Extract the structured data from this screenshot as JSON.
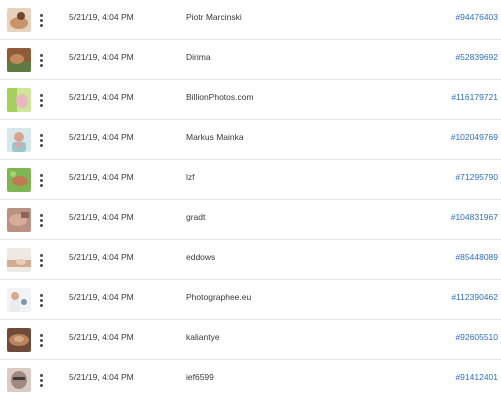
{
  "rows": [
    {
      "date": "5/21/19, 4:04 PM",
      "author": "Piotr Marcinski",
      "asset_id": "#94476403",
      "thumb_colors": [
        "#d9b48c",
        "#8a5a3a"
      ]
    },
    {
      "date": "5/21/19, 4:04 PM",
      "author": "Dirima",
      "asset_id": "#52839692",
      "thumb_colors": [
        "#a0683d",
        "#5c7a42"
      ]
    },
    {
      "date": "5/21/19, 4:04 PM",
      "author": "BillionPhotos.com",
      "asset_id": "#116179721",
      "thumb_colors": [
        "#b9d870",
        "#e6a0b0"
      ]
    },
    {
      "date": "5/21/19, 4:04 PM",
      "author": "Markus Mainka",
      "asset_id": "#102049769",
      "thumb_colors": [
        "#c5dfe0",
        "#d99a9a"
      ]
    },
    {
      "date": "5/21/19, 4:04 PM",
      "author": "lzf",
      "asset_id": "#71295790",
      "thumb_colors": [
        "#8bbf5a",
        "#b86d4a"
      ]
    },
    {
      "date": "5/21/19, 4:04 PM",
      "author": "gradt",
      "asset_id": "#104831967",
      "thumb_colors": [
        "#c79a86",
        "#8d6a5a"
      ]
    },
    {
      "date": "5/21/19, 4:04 PM",
      "author": "eddows",
      "asset_id": "#85448089",
      "thumb_colors": [
        "#e9e3dc",
        "#c49a82"
      ]
    },
    {
      "date": "5/21/19, 4:04 PM",
      "author": "Photographee.eu",
      "asset_id": "#112390462",
      "thumb_colors": [
        "#eef0f2",
        "#6f8aa8"
      ]
    },
    {
      "date": "5/21/19, 4:04 PM",
      "author": "kaliantye",
      "asset_id": "#92605510",
      "thumb_colors": [
        "#b07a5c",
        "#6d4836"
      ]
    },
    {
      "date": "5/21/19, 4:04 PM",
      "author": "ief6599",
      "asset_id": "#91412401",
      "thumb_colors": [
        "#9c8a82",
        "#d3c7c0"
      ]
    }
  ],
  "colors": {
    "link": "#2f6ec9",
    "divider": "#e6e6e6",
    "text": "#3a3a3a"
  },
  "icons": {
    "more": "more-vertical-icon"
  }
}
